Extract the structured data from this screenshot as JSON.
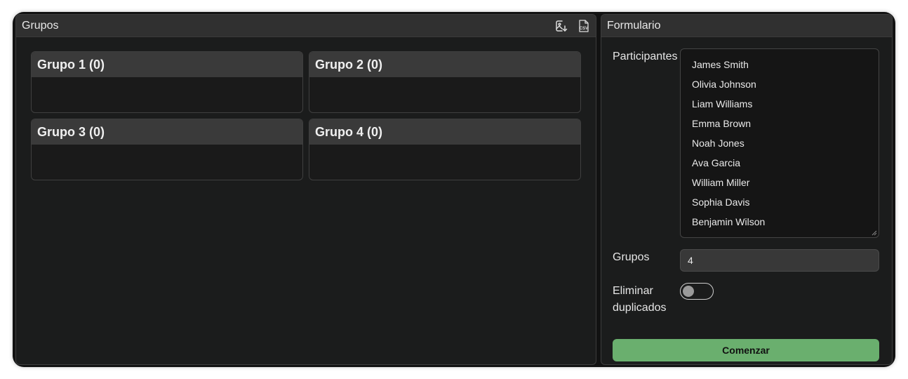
{
  "groups_panel": {
    "title": "Grupos",
    "actions": [
      {
        "icon": "image-download-icon"
      },
      {
        "icon": "csv-icon",
        "label": "CSV"
      }
    ],
    "groups": [
      {
        "title": "Grupo 1 (0)"
      },
      {
        "title": "Grupo 2 (0)"
      },
      {
        "title": "Grupo 3 (0)"
      },
      {
        "title": "Grupo 4 (0)"
      }
    ]
  },
  "form_panel": {
    "title": "Formulario",
    "participants_label": "Participantes",
    "participants": [
      "James Smith",
      "Olivia Johnson",
      "Liam Williams",
      "Emma Brown",
      "Noah Jones",
      "Ava Garcia",
      "William Miller",
      "Sophia Davis",
      "Benjamin Wilson"
    ],
    "groups_label": "Grupos",
    "groups_value": "4",
    "remove_duplicates_label_line1": "Eliminar",
    "remove_duplicates_label_line2": "duplicados",
    "remove_duplicates_on": false,
    "start_button_label": "Comenzar",
    "accent_color": "#6aaf6e"
  }
}
